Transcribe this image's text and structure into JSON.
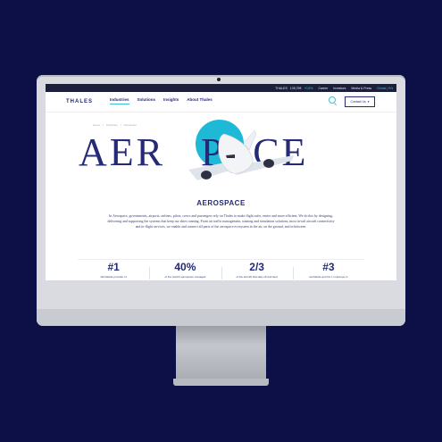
{
  "topbar": {
    "company": "THALES",
    "price": "135,75€",
    "change": "+0,8%",
    "links": [
      "Career",
      "Investors",
      "Media & Press"
    ],
    "cta": "Global | EN"
  },
  "nav": {
    "logo": "THALES",
    "items": [
      "Industries",
      "Solutions",
      "Insights",
      "About Thales"
    ],
    "contact_label": "Contact Us"
  },
  "breadcrumb": [
    "Home",
    "Industries",
    "Aerospace"
  ],
  "hero": {
    "word_left": "AER",
    "word_right": "PACE",
    "circle_color": "#1fb9d8"
  },
  "section": {
    "title": "AEROSPACE",
    "intro": "In Aerospace, governments, airports, airlines, pilots, crews and passengers rely on Thales to make flight safer, easier and more efficient. We do this by designing, delivering and supporting the systems that keep our skies running. From air traffic management, training and simulation solutions, most in-tail aircraft connectivity and in-flight services, we enable and connect all parts of the aerospace ecosystem in the air, on the ground, and in between."
  },
  "stats": [
    {
      "num": "#1",
      "desc": "Worldwide provider of"
    },
    {
      "num": "40%",
      "desc": "of the world's aerospace managed"
    },
    {
      "num": "2/3",
      "desc": "of the aircraft that take off and land"
    },
    {
      "num": "#3",
      "desc": "worldwide and No 1 in Europe in"
    }
  ],
  "colors": {
    "background": "#0c1046",
    "brand_navy": "#242a75",
    "accent_cyan": "#39c3d6"
  }
}
